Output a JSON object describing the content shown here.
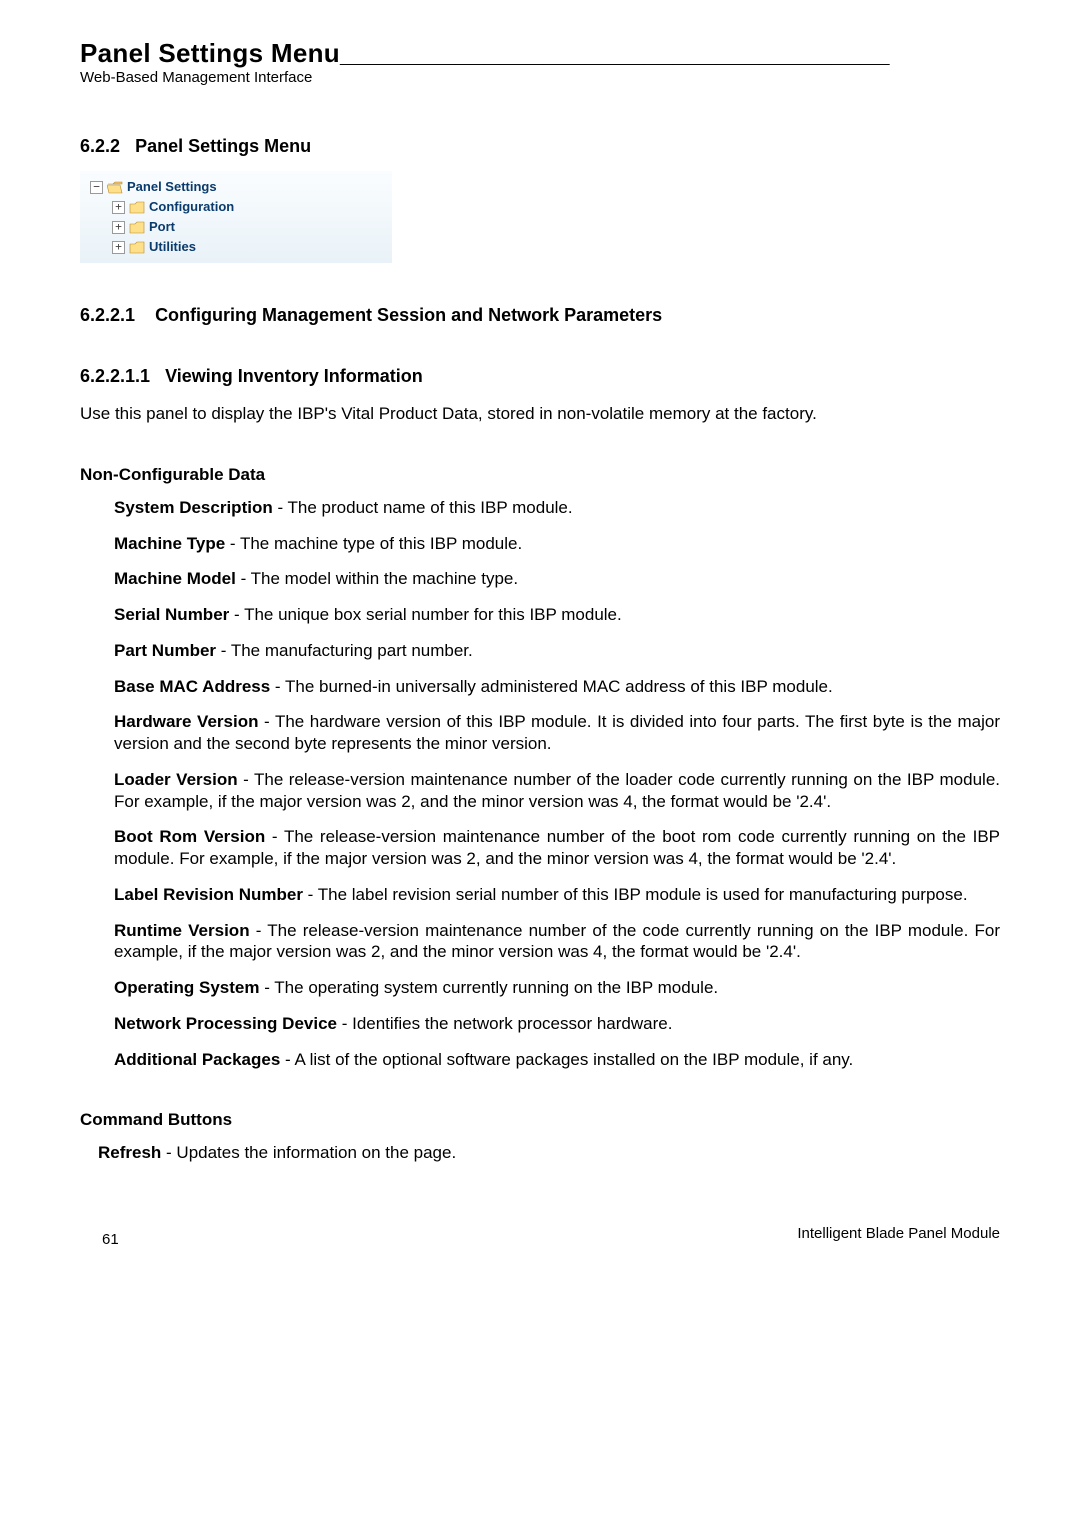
{
  "header": {
    "title": "Panel Settings Menu",
    "subtitle": "Web-Based Management Interface"
  },
  "section_6_2_2": {
    "number": "6.2.2",
    "title": "Panel Settings Menu"
  },
  "tree": {
    "root": {
      "expander": "−",
      "label": "Panel Settings"
    },
    "items": [
      {
        "expander": "+",
        "label": "Configuration"
      },
      {
        "expander": "+",
        "label": "Port"
      },
      {
        "expander": "+",
        "label": "Utilities"
      }
    ]
  },
  "section_6_2_2_1": {
    "number": "6.2.2.1",
    "title": "Configuring Management Session and Network Parameters"
  },
  "section_6_2_2_1_1": {
    "number": "6.2.2.1.1",
    "title": "Viewing Inventory Information",
    "intro": "Use this panel to display the IBP's Vital Product Data, stored in non-volatile memory at the factory."
  },
  "noncfg": {
    "heading": "Non-Configurable Data",
    "items": [
      {
        "term": "System Description",
        "desc": " - The product name of this IBP module."
      },
      {
        "term": "Machine Type",
        "desc": " - The machine type of this IBP module."
      },
      {
        "term": "Machine Model",
        "desc": " - The model within the machine type."
      },
      {
        "term": "Serial Number",
        "desc": " - The unique box serial number for this IBP module."
      },
      {
        "term": "Part Number",
        "desc": " - The manufacturing part number."
      },
      {
        "term": "Base MAC Address",
        "desc": " - The burned-in universally administered MAC address of this IBP module."
      },
      {
        "term": "Hardware Version",
        "desc": " - The hardware version of this IBP module. It is divided into four parts. The first byte is the major version and the second byte represents the minor version."
      },
      {
        "term": "Loader Version",
        "desc": " - The release-version maintenance number of the loader code currently running on the IBP module. For example, if the major version was 2, and the minor version was 4, the format would be '2.4'."
      },
      {
        "term": "Boot Rom Version",
        "desc": " - The release-version maintenance number of the boot rom code currently running on the IBP module. For example, if the major version was 2, and the minor version was 4, the format would be '2.4'."
      },
      {
        "term": "Label Revision Number",
        "desc": " - The label revision serial number of this IBP module is used for manufacturing purpose."
      },
      {
        "term": "Runtime Version",
        "desc": " - The release-version maintenance number of the code currently running on the IBP module. For example, if the major version was 2, and the minor version was 4, the format would be '2.4'."
      },
      {
        "term": "Operating System",
        "desc": " - The operating system currently running on the IBP module."
      },
      {
        "term": "Network Processing Device",
        "desc": " - Identifies the network processor hardware."
      },
      {
        "term": "Additional Packages",
        "desc": " - A list of the optional software packages installed on the IBP module, if any."
      }
    ]
  },
  "cmd": {
    "heading": "Command Buttons",
    "items": [
      {
        "term": "Refresh",
        "desc": " - Updates the information on the page."
      }
    ]
  },
  "footer": {
    "page": "61",
    "right": "Intelligent Blade Panel Module"
  }
}
